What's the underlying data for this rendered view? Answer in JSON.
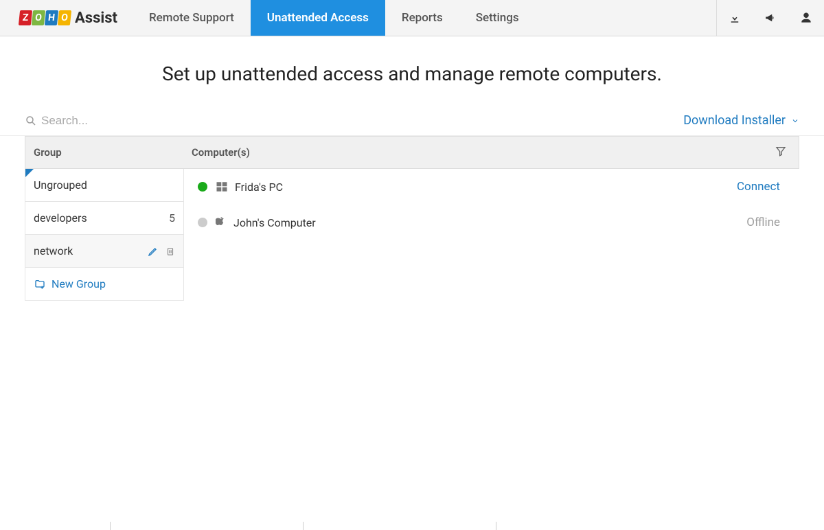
{
  "brand": {
    "assist": "Assist"
  },
  "nav": {
    "remote_support": "Remote Support",
    "unattended": "Unattended Access",
    "reports": "Reports",
    "settings": "Settings"
  },
  "page": {
    "title": "Set up unattended access and manage remote computers."
  },
  "search": {
    "placeholder": "Search..."
  },
  "download": {
    "label": "Download Installer"
  },
  "columns": {
    "group": "Group",
    "computers": "Computer(s)"
  },
  "groups": [
    {
      "name": "Ungrouped",
      "selected": true
    },
    {
      "name": "developers",
      "count": "5"
    },
    {
      "name": "network",
      "hovered": true
    },
    {
      "name": "New Group",
      "new": true
    }
  ],
  "computers": [
    {
      "name": "Frida's PC",
      "os": "windows",
      "status": "online",
      "action": "Connect"
    },
    {
      "name": "John's Computer",
      "os": "apple",
      "status": "offline",
      "action": "Offline"
    }
  ]
}
